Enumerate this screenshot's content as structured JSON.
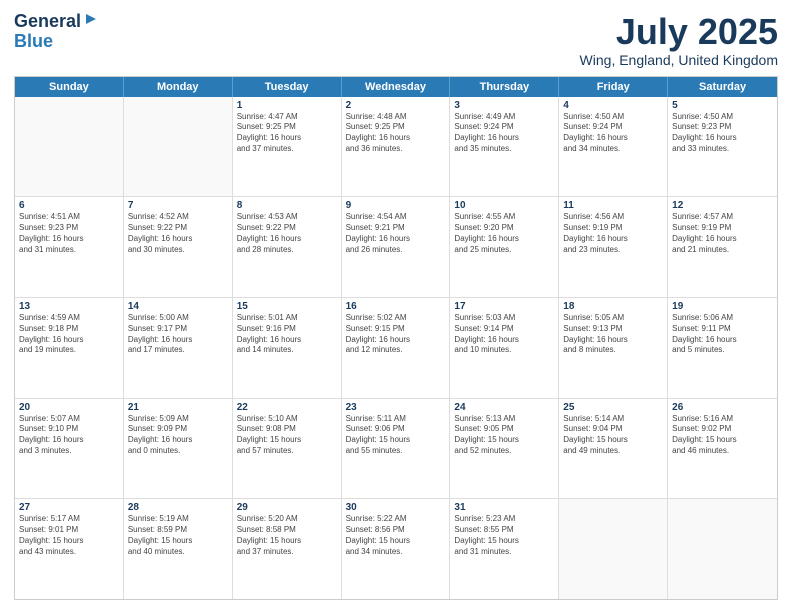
{
  "logo": {
    "line1": "General",
    "line2": "Blue"
  },
  "title": "July 2025",
  "subtitle": "Wing, England, United Kingdom",
  "header_days": [
    "Sunday",
    "Monday",
    "Tuesday",
    "Wednesday",
    "Thursday",
    "Friday",
    "Saturday"
  ],
  "weeks": [
    [
      {
        "day": "",
        "info": ""
      },
      {
        "day": "",
        "info": ""
      },
      {
        "day": "1",
        "info": "Sunrise: 4:47 AM\nSunset: 9:25 PM\nDaylight: 16 hours\nand 37 minutes."
      },
      {
        "day": "2",
        "info": "Sunrise: 4:48 AM\nSunset: 9:25 PM\nDaylight: 16 hours\nand 36 minutes."
      },
      {
        "day": "3",
        "info": "Sunrise: 4:49 AM\nSunset: 9:24 PM\nDaylight: 16 hours\nand 35 minutes."
      },
      {
        "day": "4",
        "info": "Sunrise: 4:50 AM\nSunset: 9:24 PM\nDaylight: 16 hours\nand 34 minutes."
      },
      {
        "day": "5",
        "info": "Sunrise: 4:50 AM\nSunset: 9:23 PM\nDaylight: 16 hours\nand 33 minutes."
      }
    ],
    [
      {
        "day": "6",
        "info": "Sunrise: 4:51 AM\nSunset: 9:23 PM\nDaylight: 16 hours\nand 31 minutes."
      },
      {
        "day": "7",
        "info": "Sunrise: 4:52 AM\nSunset: 9:22 PM\nDaylight: 16 hours\nand 30 minutes."
      },
      {
        "day": "8",
        "info": "Sunrise: 4:53 AM\nSunset: 9:22 PM\nDaylight: 16 hours\nand 28 minutes."
      },
      {
        "day": "9",
        "info": "Sunrise: 4:54 AM\nSunset: 9:21 PM\nDaylight: 16 hours\nand 26 minutes."
      },
      {
        "day": "10",
        "info": "Sunrise: 4:55 AM\nSunset: 9:20 PM\nDaylight: 16 hours\nand 25 minutes."
      },
      {
        "day": "11",
        "info": "Sunrise: 4:56 AM\nSunset: 9:19 PM\nDaylight: 16 hours\nand 23 minutes."
      },
      {
        "day": "12",
        "info": "Sunrise: 4:57 AM\nSunset: 9:19 PM\nDaylight: 16 hours\nand 21 minutes."
      }
    ],
    [
      {
        "day": "13",
        "info": "Sunrise: 4:59 AM\nSunset: 9:18 PM\nDaylight: 16 hours\nand 19 minutes."
      },
      {
        "day": "14",
        "info": "Sunrise: 5:00 AM\nSunset: 9:17 PM\nDaylight: 16 hours\nand 17 minutes."
      },
      {
        "day": "15",
        "info": "Sunrise: 5:01 AM\nSunset: 9:16 PM\nDaylight: 16 hours\nand 14 minutes."
      },
      {
        "day": "16",
        "info": "Sunrise: 5:02 AM\nSunset: 9:15 PM\nDaylight: 16 hours\nand 12 minutes."
      },
      {
        "day": "17",
        "info": "Sunrise: 5:03 AM\nSunset: 9:14 PM\nDaylight: 16 hours\nand 10 minutes."
      },
      {
        "day": "18",
        "info": "Sunrise: 5:05 AM\nSunset: 9:13 PM\nDaylight: 16 hours\nand 8 minutes."
      },
      {
        "day": "19",
        "info": "Sunrise: 5:06 AM\nSunset: 9:11 PM\nDaylight: 16 hours\nand 5 minutes."
      }
    ],
    [
      {
        "day": "20",
        "info": "Sunrise: 5:07 AM\nSunset: 9:10 PM\nDaylight: 16 hours\nand 3 minutes."
      },
      {
        "day": "21",
        "info": "Sunrise: 5:09 AM\nSunset: 9:09 PM\nDaylight: 16 hours\nand 0 minutes."
      },
      {
        "day": "22",
        "info": "Sunrise: 5:10 AM\nSunset: 9:08 PM\nDaylight: 15 hours\nand 57 minutes."
      },
      {
        "day": "23",
        "info": "Sunrise: 5:11 AM\nSunset: 9:06 PM\nDaylight: 15 hours\nand 55 minutes."
      },
      {
        "day": "24",
        "info": "Sunrise: 5:13 AM\nSunset: 9:05 PM\nDaylight: 15 hours\nand 52 minutes."
      },
      {
        "day": "25",
        "info": "Sunrise: 5:14 AM\nSunset: 9:04 PM\nDaylight: 15 hours\nand 49 minutes."
      },
      {
        "day": "26",
        "info": "Sunrise: 5:16 AM\nSunset: 9:02 PM\nDaylight: 15 hours\nand 46 minutes."
      }
    ],
    [
      {
        "day": "27",
        "info": "Sunrise: 5:17 AM\nSunset: 9:01 PM\nDaylight: 15 hours\nand 43 minutes."
      },
      {
        "day": "28",
        "info": "Sunrise: 5:19 AM\nSunset: 8:59 PM\nDaylight: 15 hours\nand 40 minutes."
      },
      {
        "day": "29",
        "info": "Sunrise: 5:20 AM\nSunset: 8:58 PM\nDaylight: 15 hours\nand 37 minutes."
      },
      {
        "day": "30",
        "info": "Sunrise: 5:22 AM\nSunset: 8:56 PM\nDaylight: 15 hours\nand 34 minutes."
      },
      {
        "day": "31",
        "info": "Sunrise: 5:23 AM\nSunset: 8:55 PM\nDaylight: 15 hours\nand 31 minutes."
      },
      {
        "day": "",
        "info": ""
      },
      {
        "day": "",
        "info": ""
      }
    ]
  ]
}
